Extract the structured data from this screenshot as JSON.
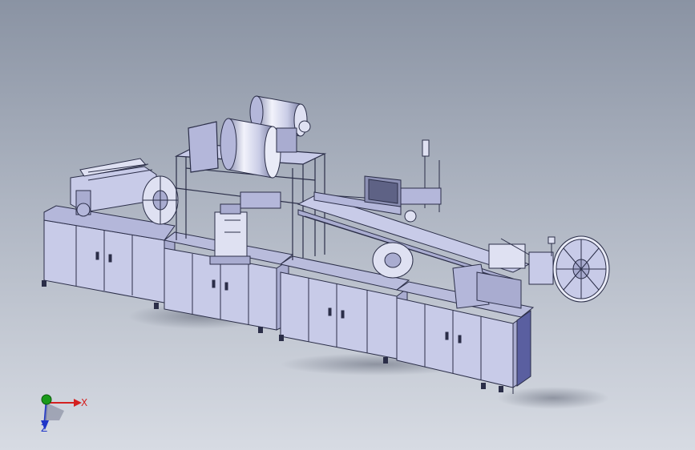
{
  "viewport": {
    "background_top": "#8a93a3",
    "background_bottom": "#d7dbe3",
    "model": {
      "body_color": "#c8cbe8",
      "frame_color": "#a9acd0",
      "edge_color": "#2b2e48",
      "shadow_color": "#6f7686"
    }
  },
  "triad": {
    "x_label": "X",
    "y_label": "",
    "z_label": "Z",
    "x_color": "#d42020",
    "y_color": "#1a9a1a",
    "z_color": "#2036c8",
    "x_icon": "arrow-right-icon",
    "y_icon": "dot-icon",
    "z_icon": "arrow-down-icon"
  }
}
